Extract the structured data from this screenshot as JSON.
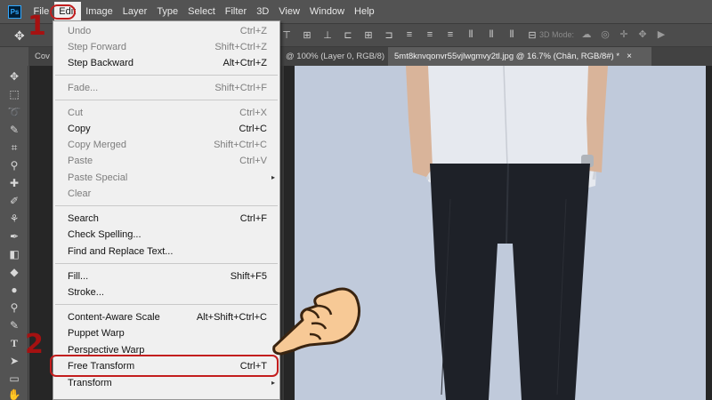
{
  "app": {
    "logo_text": "Ps",
    "menus": [
      "File",
      "Edit",
      "Image",
      "Layer",
      "Type",
      "Select",
      "Filter",
      "3D",
      "View",
      "Window",
      "Help"
    ],
    "active_menu": "Edit"
  },
  "options_bar": {
    "mode_label": "3D Mode:"
  },
  "tabs": [
    {
      "label": "Cov"
    },
    {
      "label": "@ 100% (Layer 0, RGB/8)"
    },
    {
      "label": "5mt8knvqonvr55vjlwgmvy2tl.jpg @ 16.7% (Chân, RGB/8#) *",
      "close": "×"
    }
  ],
  "edit_menu": {
    "items": [
      {
        "label": "Undo",
        "shortcut": "Ctrl+Z",
        "disabled": true
      },
      {
        "label": "Step Forward",
        "shortcut": "Shift+Ctrl+Z",
        "disabled": true
      },
      {
        "label": "Step Backward",
        "shortcut": "Alt+Ctrl+Z",
        "disabled": false
      },
      {
        "label": "Fade...",
        "shortcut": "Shift+Ctrl+F",
        "disabled": true
      },
      {
        "label": "Cut",
        "shortcut": "Ctrl+X",
        "disabled": true
      },
      {
        "label": "Copy",
        "shortcut": "Ctrl+C",
        "disabled": false
      },
      {
        "label": "Copy Merged",
        "shortcut": "Shift+Ctrl+C",
        "disabled": true
      },
      {
        "label": "Paste",
        "shortcut": "Ctrl+V",
        "disabled": true
      },
      {
        "label": "Paste Special",
        "shortcut": "",
        "disabled": true,
        "submenu": true
      },
      {
        "label": "Clear",
        "shortcut": "",
        "disabled": true
      },
      {
        "label": "Search",
        "shortcut": "Ctrl+F",
        "disabled": false
      },
      {
        "label": "Check Spelling...",
        "shortcut": "",
        "disabled": false
      },
      {
        "label": "Find and Replace Text...",
        "shortcut": "",
        "disabled": false
      },
      {
        "label": "Fill...",
        "shortcut": "Shift+F5",
        "disabled": false
      },
      {
        "label": "Stroke...",
        "shortcut": "",
        "disabled": false
      },
      {
        "label": "Content-Aware Scale",
        "shortcut": "Alt+Shift+Ctrl+C",
        "disabled": false
      },
      {
        "label": "Puppet Warp",
        "shortcut": "",
        "disabled": false
      },
      {
        "label": "Perspective Warp",
        "shortcut": "",
        "disabled": false
      },
      {
        "label": "Free Transform",
        "shortcut": "Ctrl+T",
        "disabled": false
      },
      {
        "label": "Transform",
        "shortcut": "",
        "disabled": false,
        "submenu": true
      }
    ],
    "submenu_arrow": "▸"
  },
  "annotations": {
    "step1": "1",
    "step2": "2"
  },
  "colors": {
    "annotation_red": "#c31e1e",
    "step_number_red": "#a51111",
    "canvas_bg": "#c0cadb",
    "menu_bg": "#f0f0f0"
  }
}
